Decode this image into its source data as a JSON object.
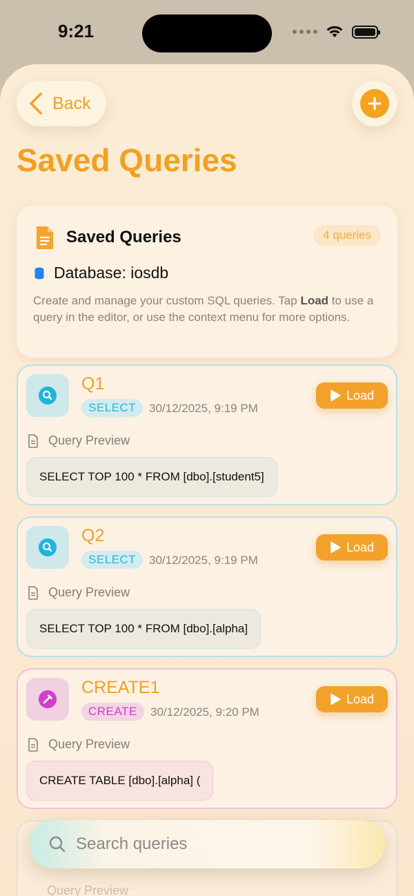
{
  "status": {
    "time": "9:21"
  },
  "header": {
    "back_label": "Back",
    "title": "Saved Queries"
  },
  "info": {
    "title": "Saved Queries",
    "count": "4 queries",
    "database": "Database: iosdb",
    "desc_before": "Create and manage your custom SQL queries. Tap ",
    "desc_bold": "Load",
    "desc_after": " to use a query in the editor, or use the context menu for more options."
  },
  "queries": [
    {
      "name": "Q1",
      "type": "SELECT",
      "date": "30/12/2025, 9:19 PM",
      "load_label": "Load",
      "preview_label": "Query Preview",
      "sql": "SELECT TOP 100 * FROM [dbo].[student5]"
    },
    {
      "name": "Q2",
      "type": "SELECT",
      "date": "30/12/2025, 9:19 PM",
      "load_label": "Load",
      "preview_label": "Query Preview",
      "sql": "SELECT TOP 100 * FROM [dbo].[alpha]"
    },
    {
      "name": "CREATE1",
      "type": "CREATE",
      "date": "30/12/2025, 9:20 PM",
      "load_label": "Load",
      "preview_label": "Query Preview",
      "sql": "CREATE TABLE [dbo].[alpha] ("
    }
  ],
  "partial_card": {
    "preview_label": "Query Preview"
  },
  "search": {
    "placeholder": "Search queries"
  },
  "colors": {
    "accent": "#f3a021",
    "select": "#29b6d8",
    "create": "#cc3fc7",
    "db_icon": "#1f86f0"
  }
}
